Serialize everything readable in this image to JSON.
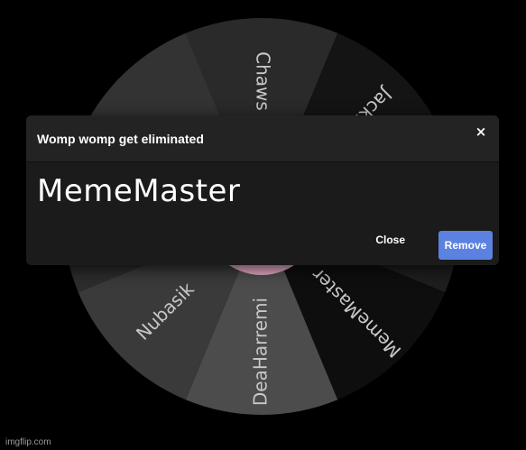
{
  "wheel": {
    "segments": [
      {
        "label": "Chaws",
        "color": "#2a2a2a"
      },
      {
        "label": "JackBlack",
        "color": "#141414"
      },
      {
        "label": "",
        "color": "#1e1e1e"
      },
      {
        "label": "MemeMaster",
        "color": "#0e0e0e"
      },
      {
        "label": "DeaHarremi",
        "color": "#4c4c4c"
      },
      {
        "label": "Nubasik",
        "color": "#3a3a3a"
      },
      {
        "label": "",
        "color": "#2c2c2c"
      },
      {
        "label": "",
        "color": "#333333"
      }
    ],
    "hub_color": "#e2a9c4"
  },
  "dialog": {
    "title": "Womp womp get eliminated",
    "close_icon": "×",
    "winner": "MemeMaster",
    "close_label": "Close",
    "remove_label": "Remove",
    "remove_color": "#5b82e0"
  },
  "watermark": "imgflip.com"
}
